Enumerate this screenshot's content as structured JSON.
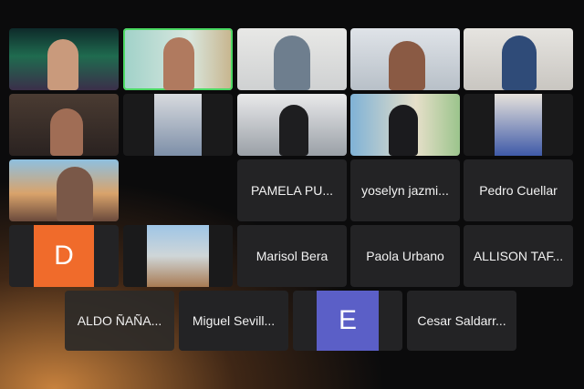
{
  "meeting": {
    "participants_named": [
      {
        "id": "pamela",
        "name": "PAMELA PU..."
      },
      {
        "id": "yoselyn",
        "name": "yoselyn jazmi..."
      },
      {
        "id": "pedro",
        "name": "Pedro Cuellar"
      },
      {
        "id": "marisol",
        "name": "Marisol Bera"
      },
      {
        "id": "paola",
        "name": "Paola Urbano"
      },
      {
        "id": "allison",
        "name": "ALLISON TAF..."
      },
      {
        "id": "aldo",
        "name": "ALDO ÑAÑA..."
      },
      {
        "id": "miguel",
        "name": "Miguel Sevill..."
      },
      {
        "id": "cesar",
        "name": "Cesar Saldarr..."
      }
    ],
    "avatars": [
      {
        "id": "d",
        "letter": "D",
        "color": "#f06b2b"
      },
      {
        "id": "e",
        "letter": "E",
        "color": "#5b5fc7"
      }
    ],
    "active_speaker_color": "#4cd964"
  }
}
